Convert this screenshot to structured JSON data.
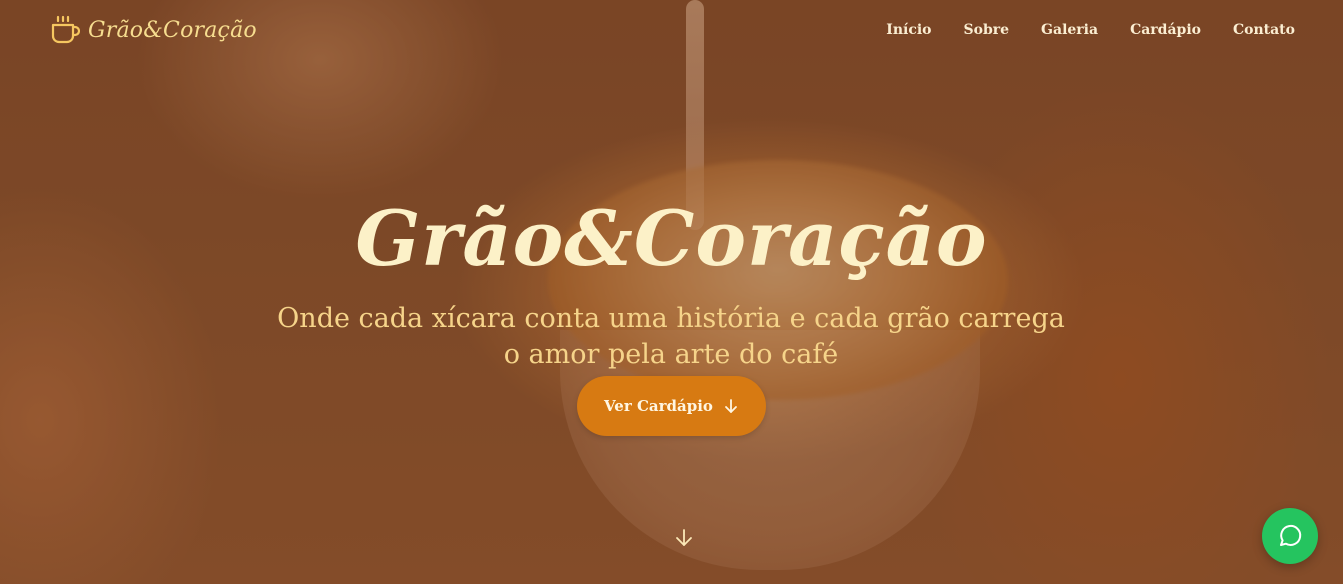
{
  "brand": {
    "name": "Grão&Coração",
    "icon": "coffee-cup-icon"
  },
  "nav": {
    "items": [
      {
        "label": "Início"
      },
      {
        "label": "Sobre"
      },
      {
        "label": "Galeria"
      },
      {
        "label": "Cardápio"
      },
      {
        "label": "Contato"
      }
    ]
  },
  "hero": {
    "title": "Grão&Coração",
    "subtitle": "Onde cada xícara conta uma história e cada grão carrega o amor pela arte do café",
    "cta_label": "Ver Cardápio",
    "cta_icon": "arrow-down-icon",
    "scroll_icon": "arrow-down-icon"
  },
  "floating": {
    "chat_icon": "whatsapp-icon"
  },
  "colors": {
    "accent": "#d77a12",
    "brand_text": "#f6dd8f",
    "whatsapp": "#25c45f"
  }
}
